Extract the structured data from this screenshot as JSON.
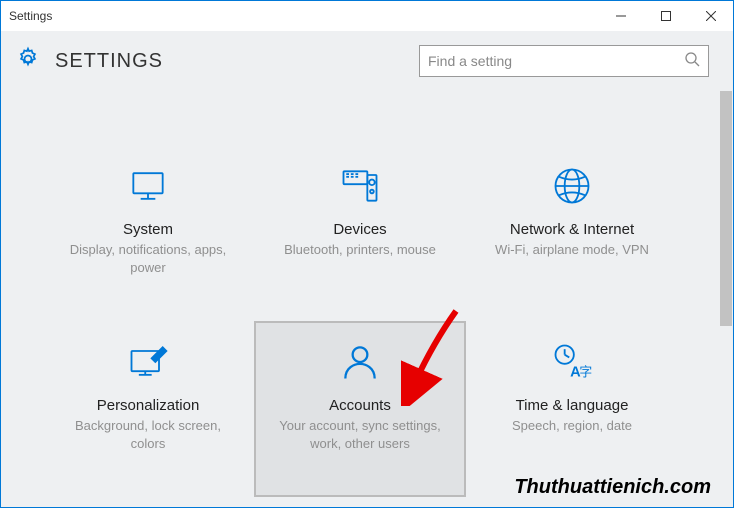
{
  "window": {
    "title": "Settings"
  },
  "header": {
    "title": "SETTINGS"
  },
  "search": {
    "placeholder": "Find a setting"
  },
  "tiles": [
    {
      "title": "System",
      "sub": "Display, notifications, apps, power"
    },
    {
      "title": "Devices",
      "sub": "Bluetooth, printers, mouse"
    },
    {
      "title": "Network & Internet",
      "sub": "Wi-Fi, airplane mode, VPN"
    },
    {
      "title": "Personalization",
      "sub": "Background, lock screen, colors"
    },
    {
      "title": "Accounts",
      "sub": "Your account, sync settings, work, other users"
    },
    {
      "title": "Time & language",
      "sub": "Speech, region, date"
    }
  ],
  "watermark": "Thuthuattienich.com",
  "colors": {
    "accent": "#0078d7",
    "icon": "#0078d7"
  }
}
